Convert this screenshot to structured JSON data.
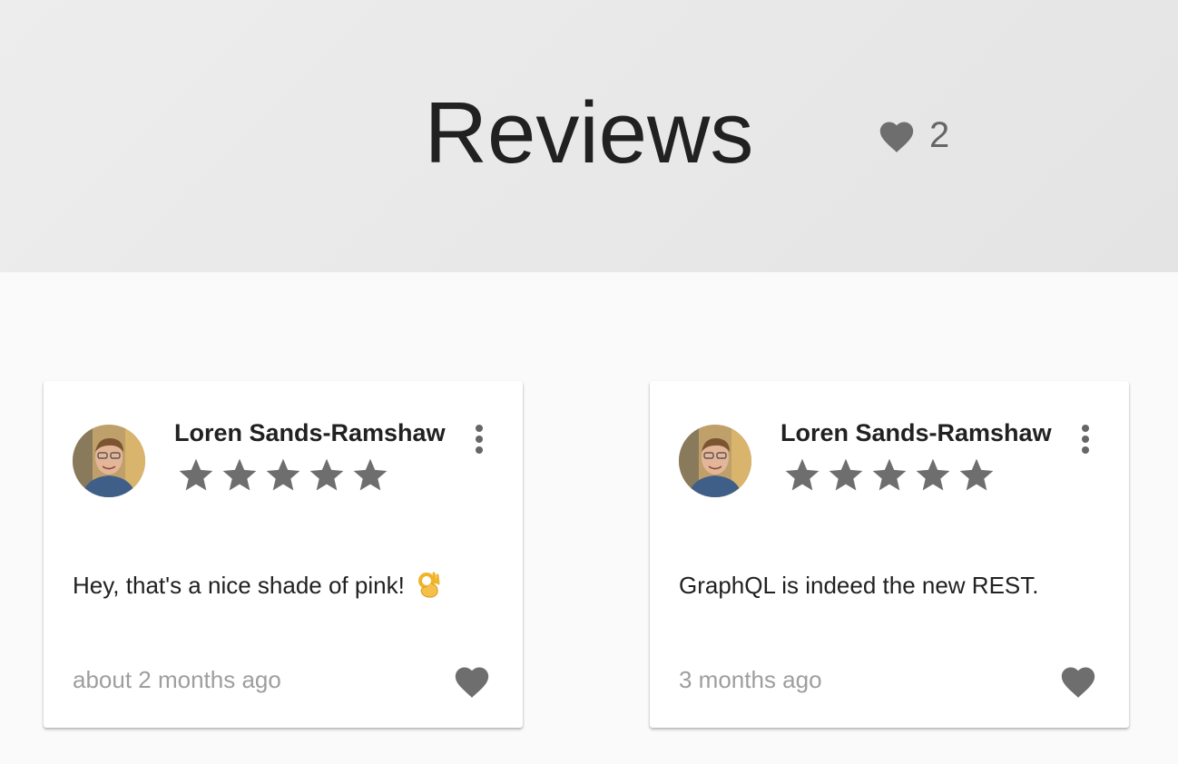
{
  "header": {
    "title": "Reviews",
    "like_count": "2",
    "icon": "heart-icon"
  },
  "reviews": [
    {
      "author": "Loren Sands-Ramshaw",
      "rating": 5,
      "text": "Hey, that's a nice shade of pink!",
      "emoji": "ok-hand-emoji",
      "time": "about 2 months ago"
    },
    {
      "author": "Loren Sands-Ramshaw",
      "rating": 5,
      "text": "GraphQL is indeed the new REST.",
      "time": "3 months ago"
    }
  ],
  "colors": {
    "header_bg": "#e8e8e8",
    "page_bg": "#fafafa",
    "icon_gray": "#6e6e6e",
    "muted_text": "#9e9e9e"
  }
}
